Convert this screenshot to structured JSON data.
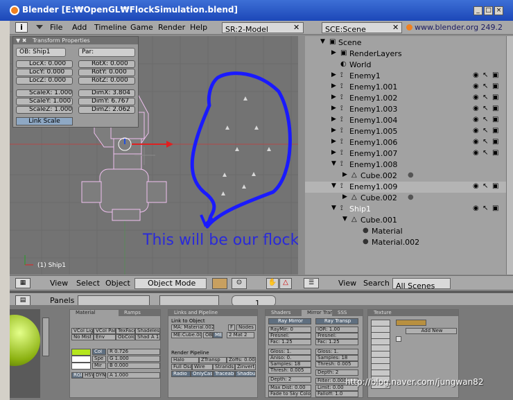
{
  "window": {
    "title": "Blender [E:₩OpenGL₩FlockSimulation.blend]"
  },
  "menubar": {
    "items": [
      "File",
      "Add",
      "Timeline",
      "Game",
      "Render",
      "Help"
    ],
    "screen": "SR:2-Model",
    "scene": "SCE:Scene",
    "site": "www.blender.org 249.2"
  },
  "transform": {
    "title": "Transform Properties",
    "ob": "OB: Ship1",
    "par": "Par:",
    "locx": "LocX: 0.000",
    "locy": "LocY: 0.000",
    "locz": "LocZ: 0.000",
    "rotx": "RotX: 0.000",
    "roty": "RotY: 0.000",
    "rotz": "RotZ: 0.000",
    "scalex": "ScaleX: 1.000",
    "scaley": "ScaleY: 1.000",
    "scalez": "ScaleZ: 1.000",
    "dimx": "DimX: 3.804",
    "dimy": "DimY: 6.767",
    "dimz": "DimZ: 2.062",
    "linkscale": "Link Scale"
  },
  "viewport": {
    "annotation": "This will be our flock",
    "object_label": "(1) Ship1"
  },
  "view_header": {
    "view": "View",
    "select": "Select",
    "object": "Object",
    "mode": "Object Mode"
  },
  "outliner": {
    "rows": [
      "Scene",
      "RenderLayers",
      "World",
      "Enemy1",
      "Enemy1.001",
      "Enemy1.002",
      "Enemy1.003",
      "Enemy1.004",
      "Enemy1.005",
      "Enemy1.006",
      "Enemy1.007",
      "Enemy1.008",
      "Cube.002",
      "Enemy1.009",
      "Cube.002",
      "Ship1",
      "Cube.001",
      "Material",
      "Material.002"
    ]
  },
  "outliner_header": {
    "view": "View",
    "search": "Search",
    "scenes": "All Scenes"
  },
  "buttons_header": {
    "panels": "Panels",
    "frame": "1"
  },
  "material_panel": {
    "tab1": "Material",
    "tab2": "Ramps",
    "row1": [
      "VCol Light",
      "VCol Paint",
      "TexFace",
      "Shadeless"
    ],
    "row2": [
      "No Mist",
      "Env",
      "ObColor",
      "Shad A 1.00"
    ],
    "col": "Col",
    "spe": "Spe",
    "mir": "Mir",
    "r": "R 0.726",
    "g": "G 1.000",
    "b": "B 0.000",
    "rgb": "RGB",
    "hsv": "HSV",
    "dyn": "DYN",
    "a": "A 1.000"
  },
  "links_panel": {
    "title": "Links and Pipeline",
    "link_to_object": "Link to Object",
    "ma": "MA: Material.002",
    "f": "F",
    "nodes": "Nodes",
    "me": "ME:Cube.001",
    "ob": "OB",
    "mebtn": "ME",
    "matcount": "2 Mat 2",
    "render_pipeline": "Render Pipeline",
    "pipe1": [
      "Halo",
      "ZTransp",
      "Zoffs: 0.00"
    ],
    "pipe2": [
      "Full Osa",
      "Wire",
      "Strands",
      "Zinvert"
    ],
    "pipe3": [
      "Radio",
      "OnlyCast",
      "Traceable",
      "Shadbuf"
    ]
  },
  "shaders_panel": {
    "tab1": "Shaders",
    "tab2": "Mirror Transp",
    "tab3": "SSS",
    "raymirror": "Ray Mirror",
    "raytransp": "Ray Transp",
    "raymir": "RayMir: 0",
    "ior": "IOR: 1.00",
    "fresnel": "Fresnel:",
    "fac": "Fac: 1.25",
    "gloss": "Gloss: 1.",
    "aniso": "Aniso: 0.",
    "samples": "Samples: 18",
    "thresh": "Thresh: 0.005",
    "depth": "Depth: 2",
    "filter": "Filter: 0.000",
    "maxdist": "Max Dist: 0.00",
    "limit": "Limit: 0.00",
    "fade": "Fade to Sky Color",
    "falloff": "Falloff: 1.0"
  },
  "texture_panel": {
    "title": "Texture",
    "addnew": "Add New"
  },
  "watermark": "http://blog.naver.com/jungwan82",
  "colors": {
    "mat_color": "#b5e61d",
    "outline_blue": "#1a1aff",
    "annot_blue": "#2a2ad8"
  }
}
